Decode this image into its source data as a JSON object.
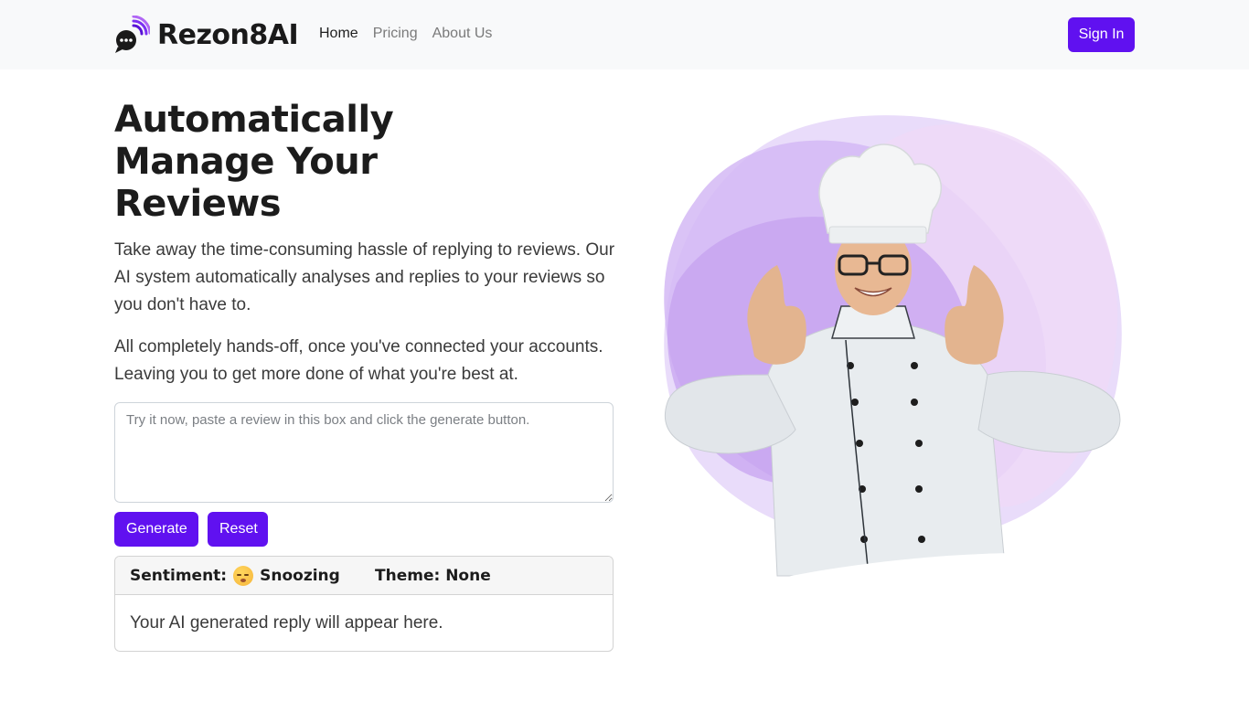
{
  "brand": {
    "name": "Rezon8AI"
  },
  "nav": {
    "items": [
      {
        "label": "Home",
        "active": true
      },
      {
        "label": "Pricing",
        "active": false
      },
      {
        "label": "About Us",
        "active": false
      }
    ],
    "signin_label": "Sign In"
  },
  "hero": {
    "title": "Automatically Manage Your Reviews",
    "lead_1": "Take away the time-consuming hassle of replying to reviews. Our AI system automatically analyses and replies to your reviews so you don't have to.",
    "lead_2": "All completely hands-off, once you've connected your accounts. Leaving you to get more done of what you're best at."
  },
  "demo": {
    "textarea_placeholder": "Try it now, paste a review in this box and click the generate button.",
    "textarea_value": "",
    "generate_label": "Generate",
    "reset_label": "Reset",
    "sentiment_label": "Sentiment:",
    "sentiment_value": "Snoozing",
    "sentiment_icon": "sleeping-face-emoji",
    "theme_text": "Theme: None",
    "reply_placeholder": "Your AI generated reply will appear here."
  },
  "colors": {
    "accent": "#6011f0",
    "navbar_bg": "#f8f9fa",
    "blob_light": "#e6d7f7",
    "blob_mid": "#c9a8f0"
  },
  "illustration": {
    "subject": "smiling chef giving two thumbs up"
  }
}
